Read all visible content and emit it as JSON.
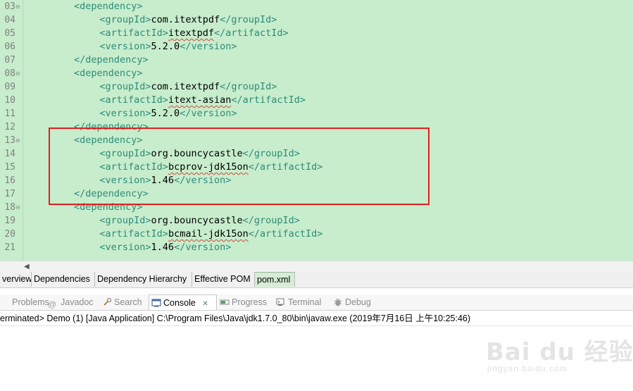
{
  "editor": {
    "lines": [
      {
        "num": "03",
        "fold": true,
        "indent": 4,
        "tag": "dependency",
        "kind": "open"
      },
      {
        "num": "04",
        "fold": false,
        "indent": 8,
        "tag": "groupId",
        "value": "com.itextpdf",
        "kind": "elem"
      },
      {
        "num": "05",
        "fold": false,
        "indent": 8,
        "tag": "artifactId",
        "value": "itextpdf",
        "kind": "elem",
        "squiggle": true
      },
      {
        "num": "06",
        "fold": false,
        "indent": 8,
        "tag": "version",
        "value": "5.2.0",
        "kind": "elem"
      },
      {
        "num": "07",
        "fold": false,
        "indent": 4,
        "tag": "dependency",
        "kind": "close"
      },
      {
        "num": "08",
        "fold": true,
        "indent": 4,
        "tag": "dependency",
        "kind": "open"
      },
      {
        "num": "09",
        "fold": false,
        "indent": 8,
        "tag": "groupId",
        "value": "com.itextpdf",
        "kind": "elem"
      },
      {
        "num": "10",
        "fold": false,
        "indent": 8,
        "tag": "artifactId",
        "value": "itext-asian",
        "kind": "elem",
        "squiggle": true
      },
      {
        "num": "11",
        "fold": false,
        "indent": 8,
        "tag": "version",
        "value": "5.2.0",
        "kind": "elem"
      },
      {
        "num": "12",
        "fold": false,
        "indent": 4,
        "tag": "dependency",
        "kind": "close"
      },
      {
        "num": "13",
        "fold": true,
        "indent": 4,
        "tag": "dependency",
        "kind": "open"
      },
      {
        "num": "14",
        "fold": false,
        "indent": 8,
        "tag": "groupId",
        "value": "org.bouncycastle",
        "kind": "elem"
      },
      {
        "num": "15",
        "fold": false,
        "indent": 8,
        "tag": "artifactId",
        "value": "bcprov-jdk15on",
        "kind": "elem",
        "squiggle": true
      },
      {
        "num": "16",
        "fold": false,
        "indent": 8,
        "tag": "version",
        "value": "1.46",
        "kind": "elem"
      },
      {
        "num": "17",
        "fold": false,
        "indent": 4,
        "tag": "dependency",
        "kind": "close"
      },
      {
        "num": "18",
        "fold": true,
        "indent": 4,
        "tag": "dependency",
        "kind": "open"
      },
      {
        "num": "19",
        "fold": false,
        "indent": 8,
        "tag": "groupId",
        "value": "org.bouncycastle",
        "kind": "elem"
      },
      {
        "num": "20",
        "fold": false,
        "indent": 8,
        "tag": "artifactId",
        "value": "bcmail-jdk15on",
        "kind": "elem",
        "squiggle": true
      },
      {
        "num": "21",
        "fold": false,
        "indent": 8,
        "tag": "version",
        "value": "1.46",
        "kind": "elem"
      }
    ]
  },
  "editor_tabs": [
    {
      "label": "verview",
      "active": false
    },
    {
      "label": "Dependencies",
      "active": false
    },
    {
      "label": "Dependency Hierarchy",
      "active": false
    },
    {
      "label": "Effective POM",
      "active": false
    },
    {
      "label": "pom.xml",
      "active": true
    }
  ],
  "view_tabs": [
    {
      "label": "Problems",
      "icon": "problems-icon",
      "active": false
    },
    {
      "label": "Javadoc",
      "icon": "javadoc-icon",
      "active": false
    },
    {
      "label": "Search",
      "icon": "search-icon",
      "active": false
    },
    {
      "label": "Console",
      "icon": "console-icon",
      "active": true
    },
    {
      "label": "Progress",
      "icon": "progress-icon",
      "active": false
    },
    {
      "label": "Terminal",
      "icon": "terminal-icon",
      "active": false
    },
    {
      "label": "Debug",
      "icon": "debug-icon",
      "active": false
    }
  ],
  "console": {
    "status": "erminated> Demo (1) [Java Application] C:\\Program Files\\Java\\jdk1.7.0_80\\bin\\javaw.exe (2019年7月16日 上午10:25:46)",
    "close_glyph": "✕"
  },
  "watermark": {
    "logo": "Bai du 经验",
    "url": "jingyan.baidu.com"
  },
  "colors": {
    "editor_bg": "#c7edcc",
    "tag": "#2e8b7a",
    "highlight": "#e02020"
  }
}
